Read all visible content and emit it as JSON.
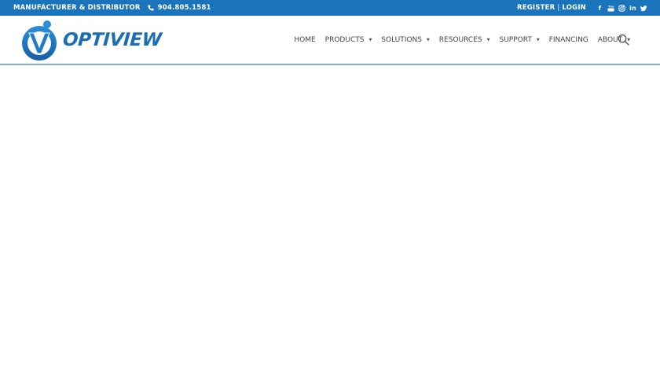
{
  "topbar": {
    "tagline": "MANUFACTURER & DISTRIBUTOR",
    "phone": "904.805.1581",
    "register": "REGISTER",
    "separator": "|",
    "login": "LOGIN",
    "social": [
      {
        "name": "facebook-icon",
        "glyph": "f"
      },
      {
        "name": "youtube-icon",
        "glyph": "▶"
      },
      {
        "name": "instagram-icon",
        "glyph": "◎"
      },
      {
        "name": "linkedin-icon",
        "glyph": "in"
      },
      {
        "name": "twitter-icon",
        "glyph": "🐦"
      }
    ],
    "background": "#1a74bb"
  },
  "header": {
    "logo_text": "OPTIVIEW",
    "brand_color": "#1a6eb5",
    "nav": [
      {
        "label": "HOME",
        "dropdown": false
      },
      {
        "label": "PRODUCTS",
        "dropdown": true
      },
      {
        "label": "SOLUTIONS",
        "dropdown": true
      },
      {
        "label": "RESOURCES",
        "dropdown": true
      },
      {
        "label": "SUPPORT",
        "dropdown": true
      },
      {
        "label": "FINANCING",
        "dropdown": false
      },
      {
        "label": "ABOUT",
        "dropdown": true
      }
    ],
    "caret": "▼"
  }
}
